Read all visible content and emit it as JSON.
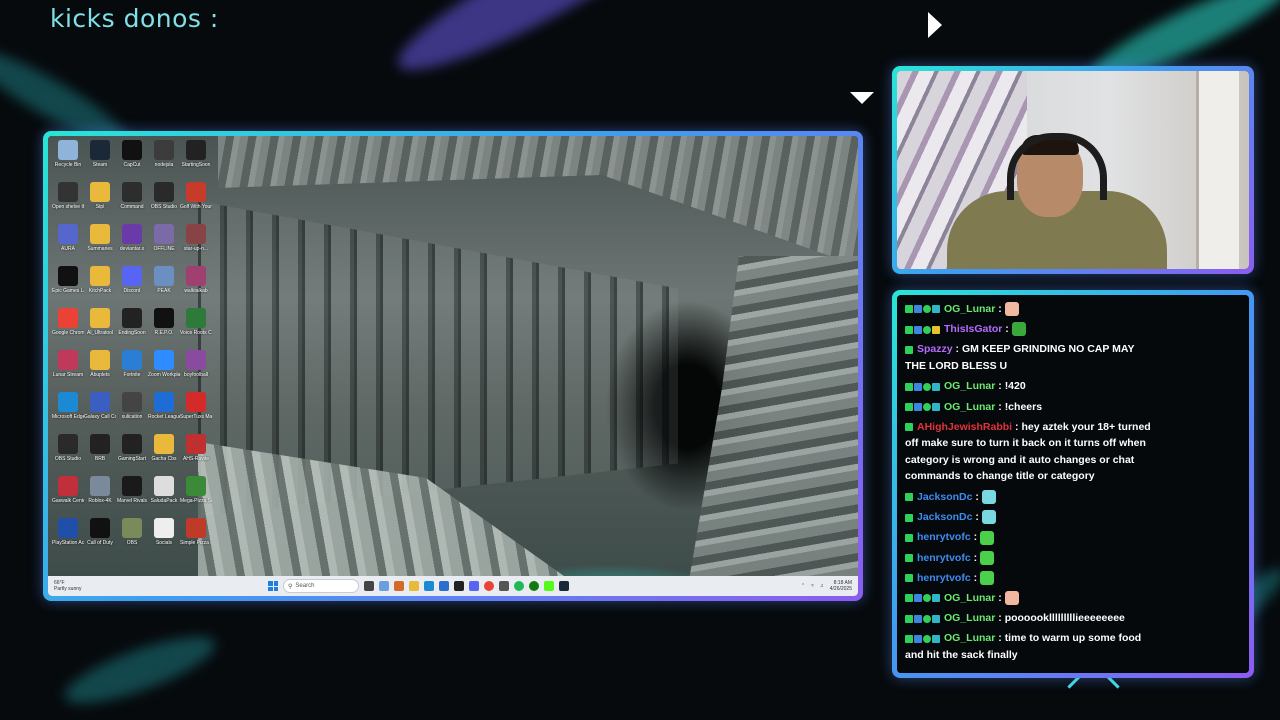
{
  "overlay": {
    "title": "kicks donos :",
    "colors": {
      "frame_start": "#28e6d6",
      "frame_end": "#8c5cf0"
    }
  },
  "desktop": {
    "icons": [
      {
        "label": "Recycle Bin",
        "icon": "recycle-bin-icon",
        "color": "#8fb3d9"
      },
      {
        "label": "Steam",
        "icon": "steam-icon",
        "color": "#1b2838"
      },
      {
        "label": "CapCut",
        "icon": "capcut-icon",
        "color": "#111111"
      },
      {
        "label": "nodejsla",
        "icon": "nodejs-icon",
        "color": "#3c3c3c"
      },
      {
        "label": "StartingSoon",
        "icon": "video-file-icon",
        "color": "#222222"
      },
      {
        "label": "Open shelve this picture",
        "icon": "shortcut-icon",
        "color": "#333333"
      },
      {
        "label": "Stpl",
        "icon": "folder-icon",
        "color": "#e8b93a"
      },
      {
        "label": "Command",
        "icon": "terminal-icon",
        "color": "#2d2d2d"
      },
      {
        "label": "OBS Studio",
        "icon": "obs-icon",
        "color": "#2a2a2a"
      },
      {
        "label": "Golf With Your Friends",
        "icon": "game-icon",
        "color": "#c73b2a"
      },
      {
        "label": "AURA",
        "icon": "app-icon",
        "color": "#5566cc"
      },
      {
        "label": "Summaries",
        "icon": "folder-icon",
        "color": "#e8b93a"
      },
      {
        "label": "deviantar.x",
        "icon": "app-icon",
        "color": "#6a3aa8"
      },
      {
        "label": "OFFLINE",
        "icon": "image-icon",
        "color": "#7a6aa8"
      },
      {
        "label": "star-up-n...",
        "icon": "app-icon",
        "color": "#884444"
      },
      {
        "label": "Epic Games Launcher",
        "icon": "epic-games-icon",
        "color": "#111111"
      },
      {
        "label": "KitchPack",
        "icon": "folder-icon",
        "color": "#e8b93a"
      },
      {
        "label": "Discord",
        "icon": "discord-icon",
        "color": "#5865f2"
      },
      {
        "label": "PEAK",
        "icon": "game-icon",
        "color": "#6b8fc0"
      },
      {
        "label": "walktalkab",
        "icon": "app-icon",
        "color": "#a04070"
      },
      {
        "label": "Google Chrome",
        "icon": "chrome-icon",
        "color": "#ea4335"
      },
      {
        "label": "AI_Ultratool",
        "icon": "folder-icon",
        "color": "#e8b93a"
      },
      {
        "label": "EndingSoon",
        "icon": "video-file-icon",
        "color": "#222222"
      },
      {
        "label": "R.E.P.O.",
        "icon": "game-icon",
        "color": "#111111"
      },
      {
        "label": "Voice Roots CHTY-C...",
        "icon": "app-icon",
        "color": "#2d7a3a"
      },
      {
        "label": "Lunar Stream",
        "icon": "app-icon",
        "color": "#c0395a"
      },
      {
        "label": "Abuplets",
        "icon": "folder-icon",
        "color": "#e8b93a"
      },
      {
        "label": "Fortnite",
        "icon": "game-icon",
        "color": "#2a7fd4"
      },
      {
        "label": "Zoom Workplace",
        "icon": "zoom-icon",
        "color": "#2d8cff"
      },
      {
        "label": "boyfoolball",
        "icon": "image-icon",
        "color": "#8a4aa0"
      },
      {
        "label": "Microsoft Edge",
        "icon": "edge-icon",
        "color": "#1b8ad2"
      },
      {
        "label": "Galaxy Call Companion",
        "icon": "app-icon",
        "color": "#3a5fc0"
      },
      {
        "label": "xulication",
        "icon": "app-icon",
        "color": "#444444"
      },
      {
        "label": "Rocket League",
        "icon": "game-icon",
        "color": "#1e6cd6"
      },
      {
        "label": "SuperTuxs Magasinhrf",
        "icon": "app-icon",
        "color": "#d42a2a"
      },
      {
        "label": "OBS Studio",
        "icon": "obs-icon",
        "color": "#2a2a2a"
      },
      {
        "label": "BRB",
        "icon": "video-file-icon",
        "color": "#222222"
      },
      {
        "label": "GamingStart",
        "icon": "video-file-icon",
        "color": "#222222"
      },
      {
        "label": "Gacha Cbs",
        "icon": "folder-icon",
        "color": "#e8b93a"
      },
      {
        "label": "AHS-Ravite",
        "icon": "game-icon",
        "color": "#c03030"
      },
      {
        "label": "Gaswalk Center",
        "icon": "app-icon",
        "color": "#c0303a"
      },
      {
        "label": "Roblox-4K",
        "icon": "game-icon",
        "color": "#7a8a9a"
      },
      {
        "label": "Marvel Rivals",
        "icon": "game-icon",
        "color": "#1a1a1a"
      },
      {
        "label": "SaludaPack",
        "icon": "file-icon",
        "color": "#dddddd"
      },
      {
        "label": "Mega-Pizza Simulator",
        "icon": "game-icon",
        "color": "#3a8a3a"
      },
      {
        "label": "PlayStation Accessories",
        "icon": "playstation-icon",
        "color": "#1f4fa8"
      },
      {
        "label": "Call of Duty",
        "icon": "cod-icon",
        "color": "#111111"
      },
      {
        "label": "OBS",
        "icon": "image-icon",
        "color": "#7a8a5a"
      },
      {
        "label": "Socials",
        "icon": "file-icon",
        "color": "#eeeeee"
      },
      {
        "label": "Simple Pizza Food Server",
        "icon": "game-icon",
        "color": "#c03a2a"
      }
    ],
    "taskbar": {
      "weather_temp": "66°F",
      "weather_desc": "Partly sunny",
      "search_placeholder": "Search",
      "time": "8:18 AM",
      "date": "4/26/2025"
    }
  },
  "chat": {
    "messages": [
      {
        "badges": [
          "k",
          "s",
          "v",
          "g"
        ],
        "user": "OG_Lunar",
        "color": "#6ee86e",
        "text": "",
        "emote": "#f0b8a0"
      },
      {
        "badges": [
          "k",
          "s",
          "v",
          "y"
        ],
        "user": "ThisIsGator",
        "color": "#b66bff",
        "text": "",
        "emote": "#3ca83c"
      },
      {
        "badges": [
          "k"
        ],
        "user": "Spazzy",
        "color": "#b66bff",
        "text": "GM KEEP GRINDING NO CAP MAY THE LORD BLESS U",
        "emote": ""
      },
      {
        "badges": [
          "k",
          "s",
          "v",
          "g"
        ],
        "user": "OG_Lunar",
        "color": "#6ee86e",
        "text": "!420",
        "emote": ""
      },
      {
        "badges": [
          "k",
          "s",
          "v",
          "g"
        ],
        "user": "OG_Lunar",
        "color": "#6ee86e",
        "text": "!cheers",
        "emote": ""
      },
      {
        "badges": [
          "k"
        ],
        "user": "AHighJewishRabbi",
        "color": "#e0343a",
        "text": "hey aztek your 18+ turned off make sure to turn it back on it turns off when category is wrong and it auto changes or chat commands to change title or category",
        "emote": ""
      },
      {
        "badges": [
          "k"
        ],
        "user": "JacksonDc",
        "color": "#3d8cf0",
        "text": "",
        "emote": "#7ad8e0"
      },
      {
        "badges": [
          "k"
        ],
        "user": "JacksonDc",
        "color": "#3d8cf0",
        "text": "",
        "emote": "#7ad8e0"
      },
      {
        "badges": [
          "k"
        ],
        "user": "henrytvofc",
        "color": "#3d8cf0",
        "text": "",
        "emote": "#4ad04a"
      },
      {
        "badges": [
          "k"
        ],
        "user": "henrytvofc",
        "color": "#3d8cf0",
        "text": "",
        "emote": "#4ad04a"
      },
      {
        "badges": [
          "k"
        ],
        "user": "henrytvofc",
        "color": "#3d8cf0",
        "text": "",
        "emote": "#4ad04a"
      },
      {
        "badges": [
          "k",
          "s",
          "v",
          "g"
        ],
        "user": "OG_Lunar",
        "color": "#6ee86e",
        "text": "",
        "emote": "#f0b8a0"
      },
      {
        "badges": [
          "k",
          "s",
          "v",
          "g"
        ],
        "user": "OG_Lunar",
        "color": "#6ee86e",
        "text": "poooooklllllllllieeeeeeee",
        "emote": ""
      },
      {
        "badges": [
          "k",
          "s",
          "v",
          "g"
        ],
        "user": "OG_Lunar",
        "color": "#6ee86e",
        "text": "time to warm up some food and hit the sack finally",
        "emote": ""
      }
    ]
  }
}
